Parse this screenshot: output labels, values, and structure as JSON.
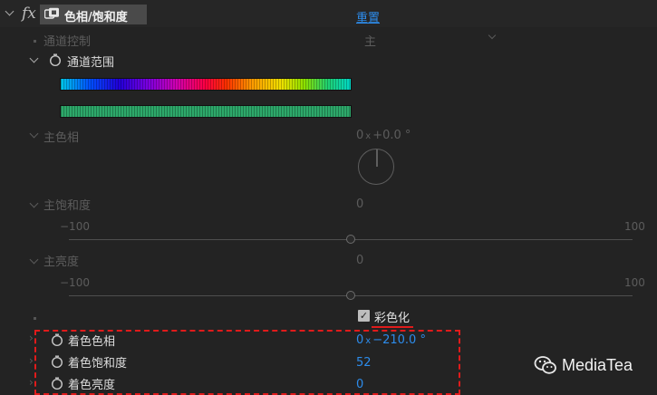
{
  "header": {
    "fx_label": "fx",
    "effect_name": "色相/饱和度",
    "reset_label": "重置"
  },
  "channel_control": {
    "label": "通道控制",
    "value": "主"
  },
  "channel_range": {
    "label": "通道范围"
  },
  "master_hue": {
    "label": "主色相",
    "revolutions": "0",
    "x_symbol": "x",
    "degrees": "+0.0",
    "degree_symbol": "°"
  },
  "master_saturation": {
    "label": "主饱和度",
    "value": "0",
    "min_label": "−100",
    "max_label": "100",
    "fraction": 0.5
  },
  "master_lightness": {
    "label": "主亮度",
    "value": "0",
    "min_label": "−100",
    "max_label": "100",
    "fraction": 0.5
  },
  "colorize": {
    "label": "彩色化",
    "checked": true,
    "check_glyph": "✓"
  },
  "colorize_hue": {
    "label": "着色色相",
    "revolutions": "0",
    "x_symbol": "x",
    "degrees": "−210.0",
    "degree_symbol": "°"
  },
  "colorize_saturation": {
    "label": "着色饱和度",
    "value": "52"
  },
  "colorize_lightness": {
    "label": "着色亮度",
    "value": "0"
  },
  "watermark": {
    "text": "MediaTea"
  },
  "colors": {
    "background": "#232323",
    "accent_blue": "#2d8ceb",
    "highlight_red": "#e01b1b",
    "green_bar": "#2da86a"
  }
}
